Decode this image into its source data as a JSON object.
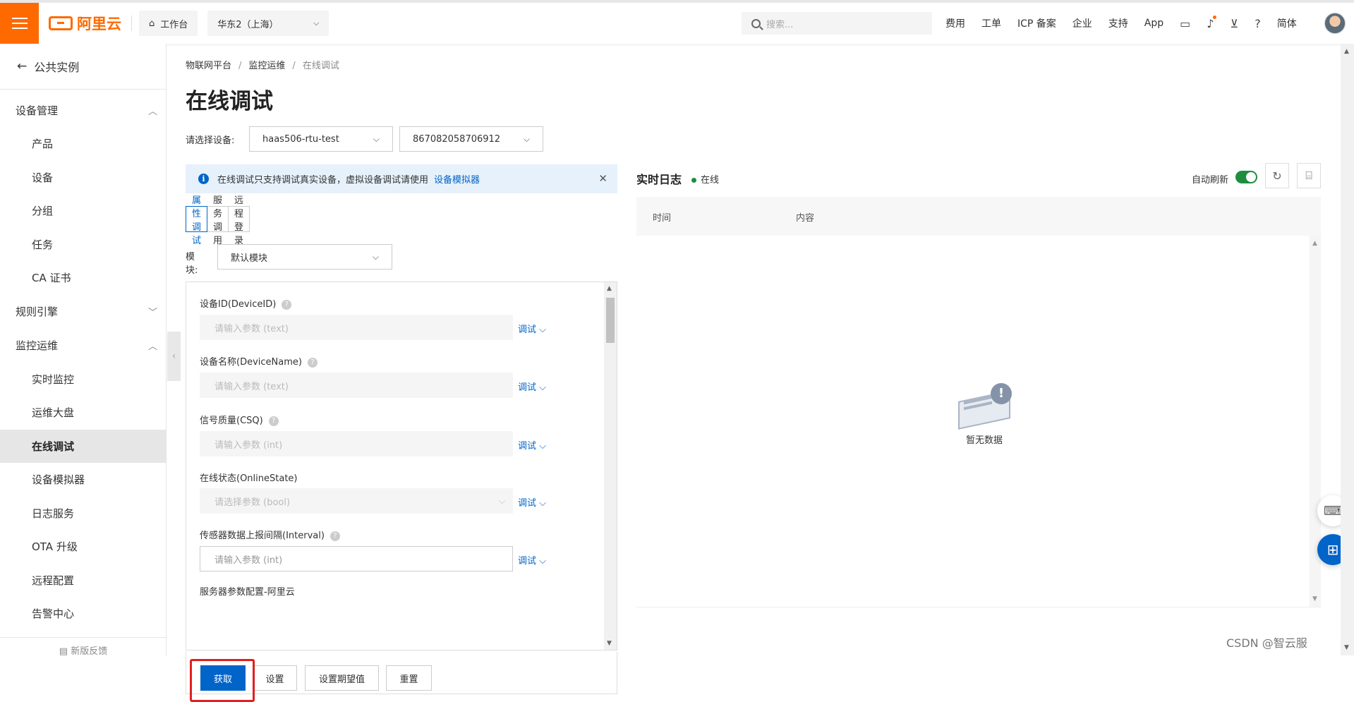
{
  "header": {
    "logo_text": "阿里云",
    "workbench": "工作台",
    "region": "华东2（上海）",
    "search_placeholder": "搜索...",
    "links": [
      "费用",
      "工单",
      "ICP 备案",
      "企业",
      "支持",
      "App"
    ],
    "lang": "简体"
  },
  "sidebar": {
    "back_label": "公共实例",
    "group_device": "设备管理",
    "device_items": [
      "产品",
      "设备",
      "分组",
      "任务",
      "CA 证书"
    ],
    "group_rules": "规则引擎",
    "group_monitor": "监控运维",
    "monitor_items": [
      "实时监控",
      "运维大盘",
      "在线调试",
      "设备模拟器",
      "日志服务",
      "OTA 升级",
      "远程配置",
      "告警中心"
    ],
    "active_item": "在线调试",
    "feedback": "新版反馈"
  },
  "breadcrumb": [
    "物联网平台",
    "监控运维",
    "在线调试"
  ],
  "page_title": "在线调试",
  "device_select": {
    "label": "请选择设备:",
    "product": "haas506-rtu-test",
    "device": "867082058706912"
  },
  "notice": {
    "text": "在线调试只支持调试真实设备，虚拟设备调试请使用",
    "link": "设备模拟器"
  },
  "tabs": [
    "属性调试",
    "服务调用",
    "远程登录"
  ],
  "active_tab": "属性调试",
  "module": {
    "label": "模块:",
    "value": "默认模块"
  },
  "properties": [
    {
      "label": "设备ID(DeviceID)",
      "placeholder": "请输入参数 (text)",
      "action": "调试"
    },
    {
      "label": "设备名称(DeviceName)",
      "placeholder": "请输入参数 (text)",
      "action": "调试"
    },
    {
      "label": "信号质量(CSQ)",
      "placeholder": "请输入参数 (int)",
      "action": "调试"
    },
    {
      "label": "在线状态(OnlineState)",
      "placeholder": "请选择参数 (bool)",
      "action": "调试"
    },
    {
      "label": "传感器数据上报间隔(Interval)",
      "placeholder": "请输入参数 (int)",
      "action": "调试"
    },
    {
      "label": "服务器参数配置-阿里云"
    }
  ],
  "actions": {
    "get": "获取",
    "set": "设置",
    "set_expected": "设置期望值",
    "reset": "重置"
  },
  "log": {
    "title": "实时日志",
    "status": "在线",
    "auto_refresh": "自动刷新",
    "auto_refresh_on": true,
    "columns": [
      "时间",
      "内容"
    ],
    "empty_text": "暂无数据"
  },
  "watermark": "CSDN @智云服",
  "colors": {
    "brand": "#ff6a00",
    "primary": "#0064c8",
    "success": "#1e8e3e",
    "highlight": "#e02020"
  }
}
